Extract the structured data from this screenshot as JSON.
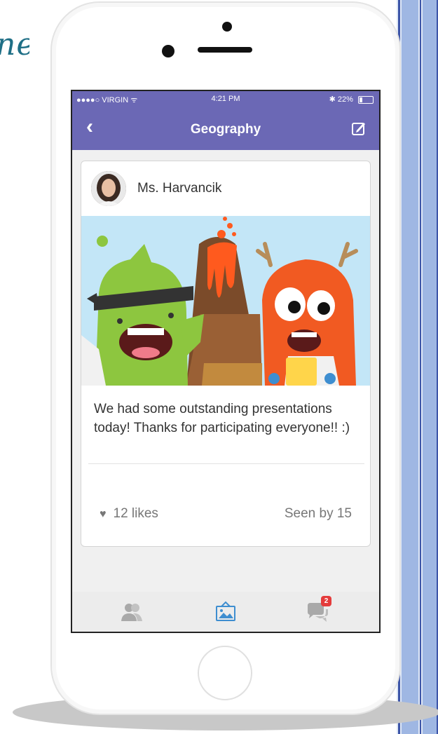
{
  "background_text": "ne",
  "status_bar": {
    "carrier": "●●●●○ VIRGIN ᯤ",
    "time": "4:21 PM",
    "battery": "22%",
    "battery_level": 0.22
  },
  "nav": {
    "back_icon": "chevron-left-icon",
    "title": "Geography",
    "compose_icon": "compose-icon"
  },
  "post": {
    "author": "Ms. Harvancik",
    "text": "We had some outstanding presentations today! Thanks for participating everyone!! :)",
    "likes": "12 likes",
    "seen": "Seen by 15"
  },
  "tabs": [
    {
      "icon": "people-icon"
    },
    {
      "icon": "story-icon",
      "active": true
    },
    {
      "icon": "messages-icon",
      "badge": "2"
    }
  ],
  "colors": {
    "brand": "#6b68b5",
    "active_tab": "#3e8ed0",
    "badge": "#e43b3b",
    "stripe_blue": "#9fb7e3",
    "stripe_dark": "#3d55a8"
  }
}
